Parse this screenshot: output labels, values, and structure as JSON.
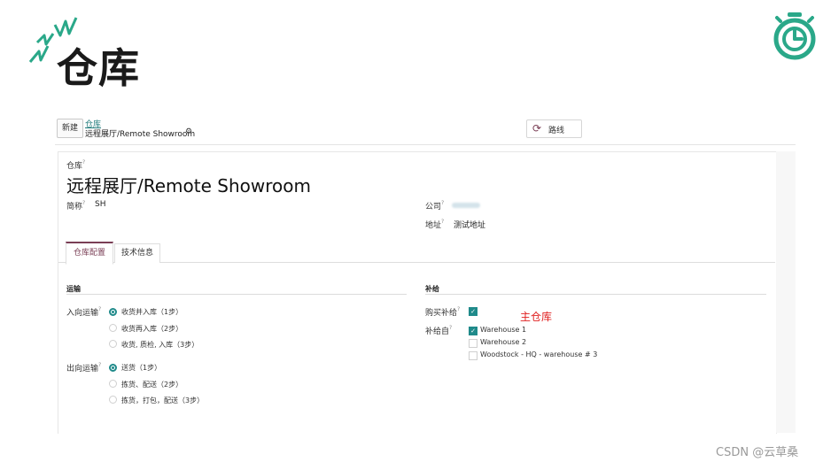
{
  "slide": {
    "title": "仓库",
    "watermark": "CSDN @云草桑"
  },
  "control_panel": {
    "new_button": "新建",
    "breadcrumb_parent": "仓库",
    "breadcrumb_current": "远程展厅/Remote Showroom",
    "routes_button": "路线"
  },
  "form": {
    "field_label": "仓库",
    "name": "远程展厅/Remote Showroom",
    "short_name_label": "简称",
    "short_name": "SH",
    "company_label": "公司",
    "address_label": "地址",
    "address": "测试地址",
    "tabs": [
      {
        "label": "仓库配置",
        "active": true
      },
      {
        "label": "技术信息",
        "active": false
      }
    ],
    "shipping": {
      "title": "运输",
      "incoming_label": "入向运输",
      "incoming_options": [
        {
          "label": "收货并入库（1步）",
          "selected": true
        },
        {
          "label": "收货再入库（2步）",
          "selected": false
        },
        {
          "label": "收货, 质检, 入库（3步）",
          "selected": false
        }
      ],
      "outgoing_label": "出向运输",
      "outgoing_options": [
        {
          "label": "送货（1步）",
          "selected": true
        },
        {
          "label": "拣货、配送（2步）",
          "selected": false
        },
        {
          "label": "拣货，打包，配送（3步）",
          "selected": false
        }
      ]
    },
    "resupply": {
      "title": "补给",
      "buy_label": "购买补给",
      "buy_checked": true,
      "from_label": "补给自",
      "warehouses": [
        {
          "label": "Warehouse 1",
          "checked": true
        },
        {
          "label": "Warehouse 2",
          "checked": false
        },
        {
          "label": "Woodstock - HQ - warehouse # 3",
          "checked": false
        }
      ]
    }
  },
  "annotation": "主仓库",
  "colors": {
    "accent": "#7a3e55",
    "teal": "#1f8a8a",
    "annotation": "#e02020",
    "logo": "#2aa889"
  },
  "icons": {
    "routes": "refresh-icon",
    "gear": "gear-icon",
    "timer": "stopwatch-icon",
    "spark": "spark-decoration-icon"
  }
}
